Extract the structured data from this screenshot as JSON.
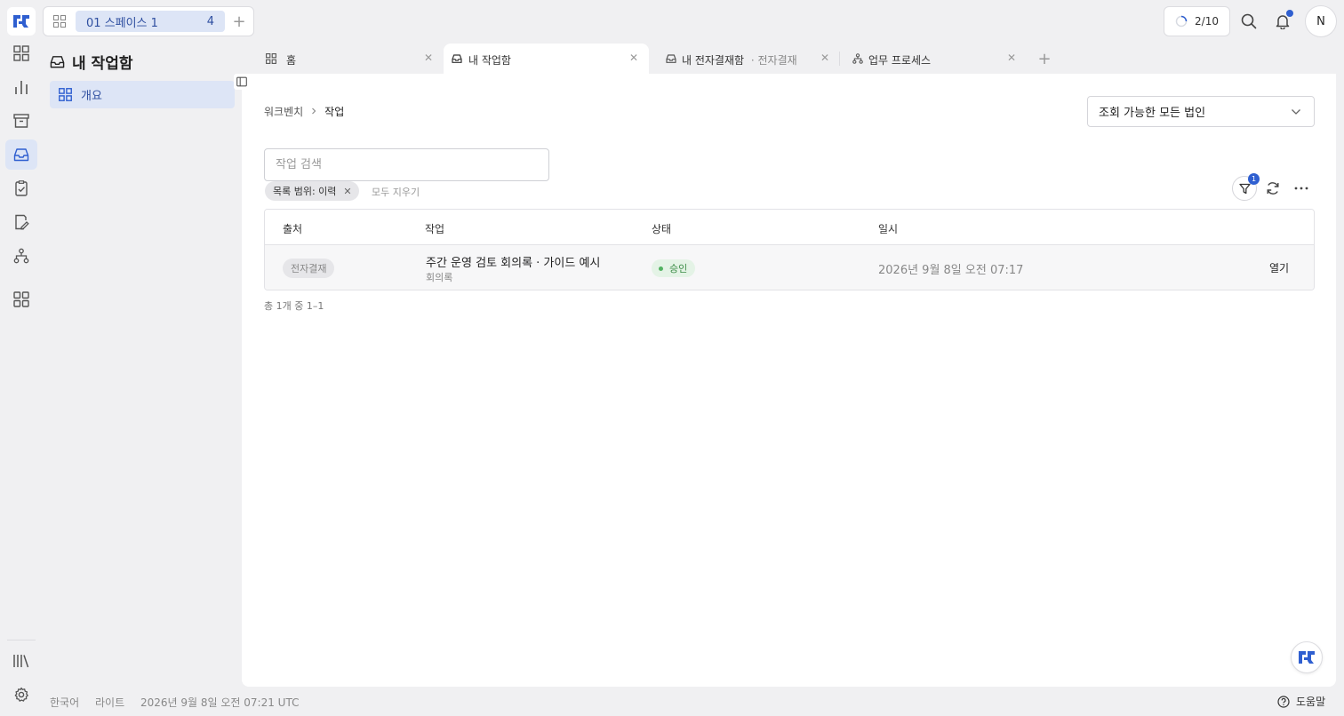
{
  "brand": {
    "accent": "#2f5fd0",
    "logo_icon": "brand-logo-icon"
  },
  "topbar": {
    "space_name": "01 스페이스 1",
    "space_count": "4",
    "progress": "2/10",
    "avatar_initial": "N"
  },
  "rail": {
    "items": [
      "grid-icon",
      "chart-icon",
      "archive-icon",
      "inbox-icon",
      "checklist-icon",
      "edit-doc-icon",
      "org-chart-icon",
      "apps-icon"
    ],
    "active": "inbox-icon",
    "bottom": [
      "library-icon",
      "settings-icon"
    ]
  },
  "panel": {
    "title": "내 작업함",
    "nav": [
      {
        "label": "개요",
        "active": true
      }
    ]
  },
  "tabs": [
    {
      "label": "홈",
      "active": false
    },
    {
      "label": "내 작업함",
      "active": true
    },
    {
      "label": "내 전자결재함",
      "suffix": "· 전자결재",
      "active": false
    },
    {
      "label": "업무 프로세스",
      "active": false
    }
  ],
  "breadcrumb": [
    "워크벤치",
    "작업"
  ],
  "entity_select": {
    "value": "조회 가능한 모든 법인"
  },
  "search": {
    "placeholder": "작업 검색",
    "value": ""
  },
  "filters": {
    "chips": [
      "목록 범위: 이력"
    ],
    "clear_label": "모두 지우기",
    "badge_count": "1"
  },
  "table": {
    "columns": [
      "출처",
      "작업",
      "상태",
      "일시"
    ],
    "rows": [
      {
        "source": "전자결재",
        "title": "주간 운영 검토 회의록 · 가이드 예시",
        "subtitle": "회의록",
        "status": "승인",
        "datetime": "2026년 9월 8일 오전 07:17",
        "action": "열기"
      }
    ]
  },
  "pagination": "총 1개 중 1–1",
  "footer": {
    "language": "한국어",
    "theme": "라이트",
    "clock": "2026년 9월 8일 오전 07:21 UTC",
    "help": "도움말"
  }
}
